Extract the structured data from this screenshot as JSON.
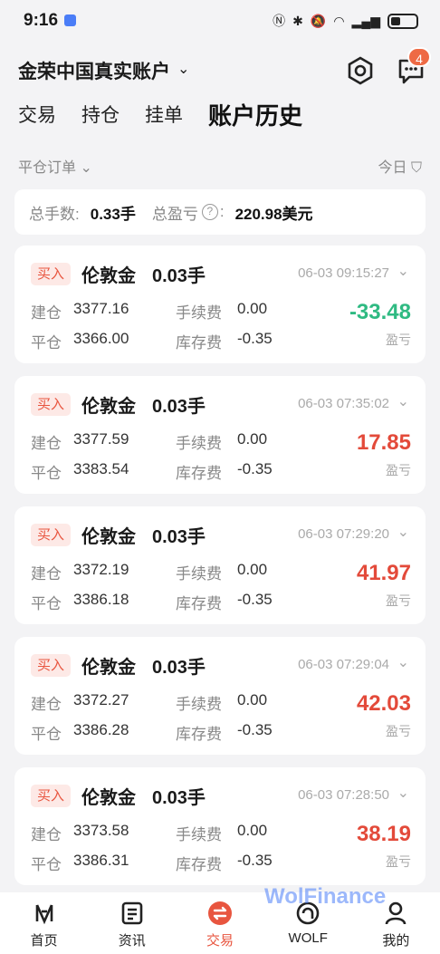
{
  "status": {
    "time": "9:16"
  },
  "header": {
    "account_title": "金荣中国真实账户",
    "message_badge": "4"
  },
  "tabs": [
    {
      "label": "交易"
    },
    {
      "label": "持仓"
    },
    {
      "label": "挂单"
    },
    {
      "label": "账户历史"
    }
  ],
  "filter": {
    "left": "平仓订单",
    "right": "今日"
  },
  "summary": {
    "lots_label": "总手数:",
    "lots_value": "0.33手",
    "pnl_label": "总盈亏",
    "pnl_value": "220.98美元"
  },
  "labels": {
    "open": "建仓",
    "close": "平仓",
    "fee": "手续费",
    "swap": "库存费",
    "pnl": "盈亏"
  },
  "orders": [
    {
      "side": "买入",
      "symbol": "伦敦金",
      "lots": "0.03手",
      "time": "06-03 09:15:27",
      "open": "3377.16",
      "close": "3366.00",
      "fee": "0.00",
      "swap": "-0.35",
      "pnl": "-33.48"
    },
    {
      "side": "买入",
      "symbol": "伦敦金",
      "lots": "0.03手",
      "time": "06-03 07:35:02",
      "open": "3377.59",
      "close": "3383.54",
      "fee": "0.00",
      "swap": "-0.35",
      "pnl": "17.85"
    },
    {
      "side": "买入",
      "symbol": "伦敦金",
      "lots": "0.03手",
      "time": "06-03 07:29:20",
      "open": "3372.19",
      "close": "3386.18",
      "fee": "0.00",
      "swap": "-0.35",
      "pnl": "41.97"
    },
    {
      "side": "买入",
      "symbol": "伦敦金",
      "lots": "0.03手",
      "time": "06-03 07:29:04",
      "open": "3372.27",
      "close": "3386.28",
      "fee": "0.00",
      "swap": "-0.35",
      "pnl": "42.03"
    },
    {
      "side": "买入",
      "symbol": "伦敦金",
      "lots": "0.03手",
      "time": "06-03 07:28:50",
      "open": "3373.58",
      "close": "3386.31",
      "fee": "0.00",
      "swap": "-0.35",
      "pnl": "38.19"
    }
  ],
  "nav": [
    {
      "label": "首页",
      "icon": "home-icon"
    },
    {
      "label": "资讯",
      "icon": "news-icon"
    },
    {
      "label": "交易",
      "icon": "trade-icon"
    },
    {
      "label": "WOLF",
      "icon": "wolf-icon"
    },
    {
      "label": "我的",
      "icon": "profile-icon"
    }
  ],
  "watermark": "WolFinance",
  "colors": {
    "accent": "#e8553f",
    "profit": "#e34a3a",
    "loss": "#2fba82",
    "badge": "#ee6a45"
  }
}
